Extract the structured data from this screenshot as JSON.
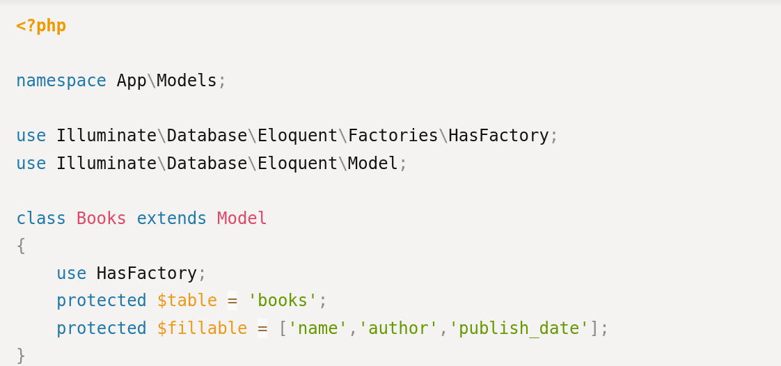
{
  "code_blocks": [
    [
      {
        "tokens": [
          {
            "text": "<?php",
            "kind": "tag"
          }
        ]
      }
    ],
    [
      {
        "tokens": [
          {
            "text": "namespace ",
            "kind": "keyword"
          },
          {
            "text": "App",
            "kind": "name"
          },
          {
            "text": "\\",
            "kind": "punct"
          },
          {
            "text": "Models",
            "kind": "name"
          },
          {
            "text": ";",
            "kind": "punct"
          }
        ]
      }
    ],
    [
      {
        "tokens": [
          {
            "text": "use ",
            "kind": "keyword"
          },
          {
            "text": "Illuminate",
            "kind": "name"
          },
          {
            "text": "\\",
            "kind": "punct"
          },
          {
            "text": "Database",
            "kind": "name"
          },
          {
            "text": "\\",
            "kind": "punct"
          },
          {
            "text": "Eloquent",
            "kind": "name"
          },
          {
            "text": "\\",
            "kind": "punct"
          },
          {
            "text": "Factories",
            "kind": "name"
          },
          {
            "text": "\\",
            "kind": "punct"
          },
          {
            "text": "HasFactory",
            "kind": "name"
          },
          {
            "text": ";",
            "kind": "punct"
          }
        ]
      },
      {
        "tokens": [
          {
            "text": "use ",
            "kind": "keyword"
          },
          {
            "text": "Illuminate",
            "kind": "name"
          },
          {
            "text": "\\",
            "kind": "punct"
          },
          {
            "text": "Database",
            "kind": "name"
          },
          {
            "text": "\\",
            "kind": "punct"
          },
          {
            "text": "Eloquent",
            "kind": "name"
          },
          {
            "text": "\\",
            "kind": "punct"
          },
          {
            "text": "Model",
            "kind": "name"
          },
          {
            "text": ";",
            "kind": "punct"
          }
        ]
      }
    ],
    [
      {
        "tokens": [
          {
            "text": "class ",
            "kind": "keyword"
          },
          {
            "text": "Books ",
            "kind": "class"
          },
          {
            "text": "extends ",
            "kind": "keyword"
          },
          {
            "text": "Model",
            "kind": "class"
          }
        ]
      },
      {
        "tokens": [
          {
            "text": "{",
            "kind": "punct"
          }
        ],
        "children": [
          {
            "tokens": [
              {
                "text": "use ",
                "kind": "keyword"
              },
              {
                "text": "HasFactory",
                "kind": "name"
              },
              {
                "text": ";",
                "kind": "punct"
              }
            ]
          },
          {
            "tokens": [
              {
                "text": "protected ",
                "kind": "keyword"
              },
              {
                "text": "$table ",
                "kind": "variable"
              },
              {
                "text": "=",
                "kind": "operator"
              },
              {
                "text": "'books'",
                "kind": "string"
              },
              {
                "text": ";",
                "kind": "punct"
              }
            ]
          },
          {
            "tokens": [
              {
                "text": "protected ",
                "kind": "keyword"
              },
              {
                "text": "$fillable ",
                "kind": "variable"
              },
              {
                "text": "=",
                "kind": "operator"
              },
              {
                "text": "[",
                "kind": "punct"
              },
              {
                "text": "'name'",
                "kind": "string"
              },
              {
                "text": ",",
                "kind": "punct"
              },
              {
                "text": "'author'",
                "kind": "string"
              },
              {
                "text": ",",
                "kind": "punct"
              },
              {
                "text": "'publish_date'",
                "kind": "string"
              },
              {
                "text": "];",
                "kind": "punct"
              }
            ]
          }
        ]
      },
      {
        "tokens": [
          {
            "text": "}",
            "kind": "punct"
          }
        ]
      }
    ]
  ]
}
